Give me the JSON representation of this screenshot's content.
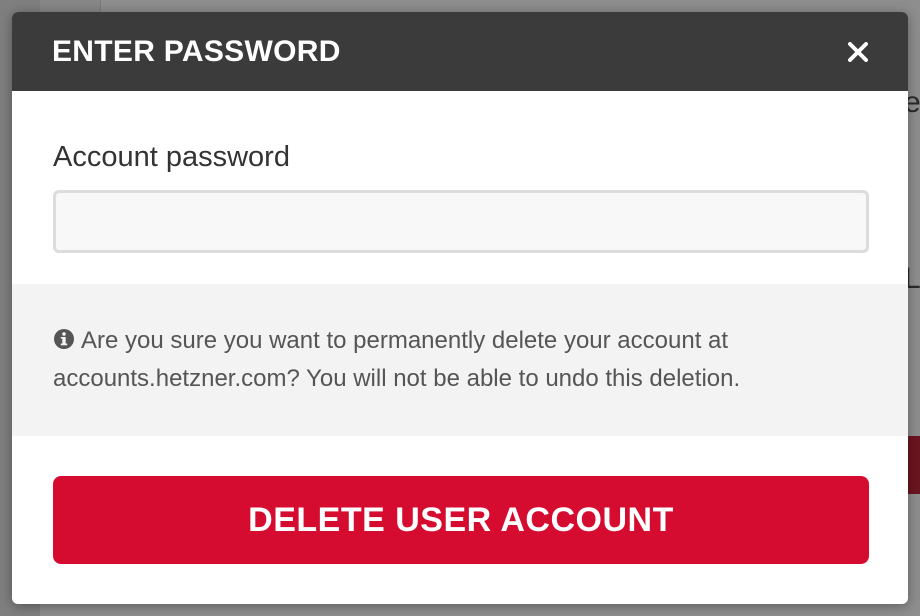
{
  "background": {
    "fragment_top": "e",
    "fragment_mid": "L"
  },
  "modal": {
    "title": "ENTER PASSWORD",
    "close_icon": "close-icon"
  },
  "form": {
    "password_label": "Account password",
    "password_value": "",
    "password_placeholder": ""
  },
  "notice": {
    "icon": "info-icon",
    "text": "Are you sure you want to permanently delete your account at accounts.hetzner.com? You will not be able to undo this deletion."
  },
  "actions": {
    "delete_label": "DELETE USER ACCOUNT"
  },
  "colors": {
    "header_bg": "#3b3b3b",
    "danger": "#d50c2f",
    "notice_bg": "#f3f3f3"
  }
}
